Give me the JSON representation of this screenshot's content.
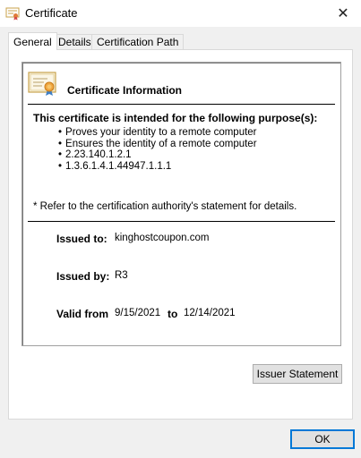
{
  "window": {
    "title": "Certificate",
    "close_glyph": "✕"
  },
  "tabs": [
    {
      "label": "General",
      "active": true
    },
    {
      "label": "Details",
      "active": false
    },
    {
      "label": "Certification Path",
      "active": false
    }
  ],
  "cert": {
    "heading": "Certificate Information",
    "purpose_heading": "This certificate is intended for the following purpose(s):",
    "purposes": [
      "Proves your identity to a remote computer",
      "Ensures the identity of a remote computer",
      "2.23.140.1.2.1",
      "1.3.6.1.4.1.44947.1.1.1"
    ],
    "note": "* Refer to the certification authority's statement for details.",
    "issued_to_label": "Issued to:",
    "issued_to": "kinghostcoupon.com",
    "issued_by_label": "Issued by:",
    "issued_by": "R3",
    "valid_from_label": "Valid from",
    "valid_from": "9/15/2021",
    "valid_to_label": "to",
    "valid_to": "12/14/2021"
  },
  "buttons": {
    "issuer_statement": "Issuer Statement",
    "ok": "OK"
  },
  "colors": {
    "accent": "#0078d7",
    "panel_border": "#d9d9d9",
    "button_face": "#e1e1e1"
  },
  "icons": {
    "title": "certificate-icon",
    "cert": "certificate-ribbon-icon"
  }
}
